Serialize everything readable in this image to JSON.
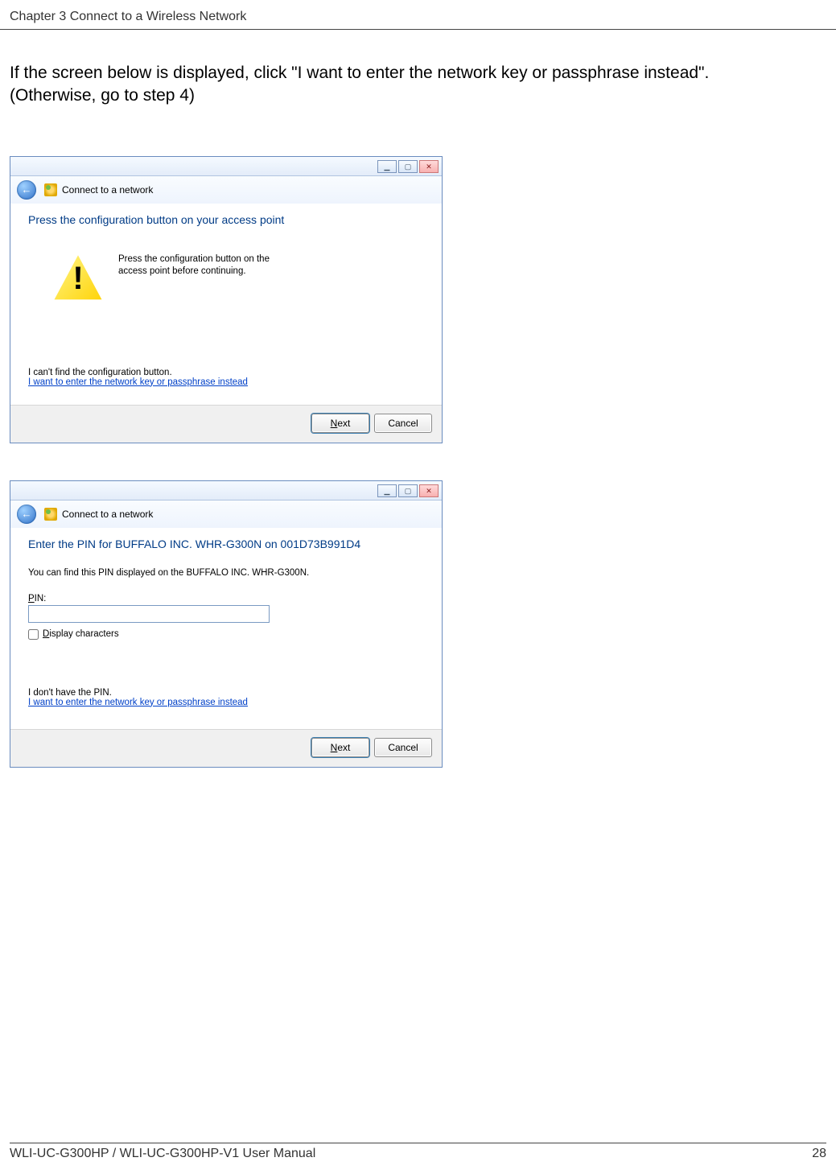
{
  "header": {
    "chapter_text": "Chapter 3  Connect to a Wireless Network"
  },
  "body": {
    "line1": "If the screen below is displayed, click \"I want to enter the network key or passphrase instead\".",
    "line2": "(Otherwise, go to step 4)"
  },
  "dialog1": {
    "window_title": "Connect to a network",
    "heading": "Press the configuration button on your access point",
    "instruction_a": "Press the configuration button on the",
    "instruction_b": "access point before continuing.",
    "plain": "I can't find the configuration button.",
    "link": "I want to enter the network key or passphrase instead",
    "next_u": "N",
    "next_rest": "ext",
    "cancel": "Cancel",
    "min": "▁",
    "max": "▢",
    "close": "✕",
    "back": "←"
  },
  "dialog2": {
    "window_title": "Connect to a network",
    "heading": "Enter the PIN for BUFFALO INC. WHR-G300N on 001D73B991D4",
    "info": "You can find this PIN displayed on the BUFFALO INC. WHR-G300N.",
    "pin_u": "P",
    "pin_rest": "IN:",
    "display_u": "D",
    "display_rest": "isplay characters",
    "plain": "I don't have the PIN.",
    "link": "I want to enter the network key or passphrase instead",
    "next_u": "N",
    "next_rest": "ext",
    "cancel": "Cancel",
    "min": "▁",
    "max": "▢",
    "close": "✕",
    "back": "←"
  },
  "footer": {
    "manual": "WLI-UC-G300HP / WLI-UC-G300HP-V1 User Manual",
    "pagenum": "28"
  }
}
